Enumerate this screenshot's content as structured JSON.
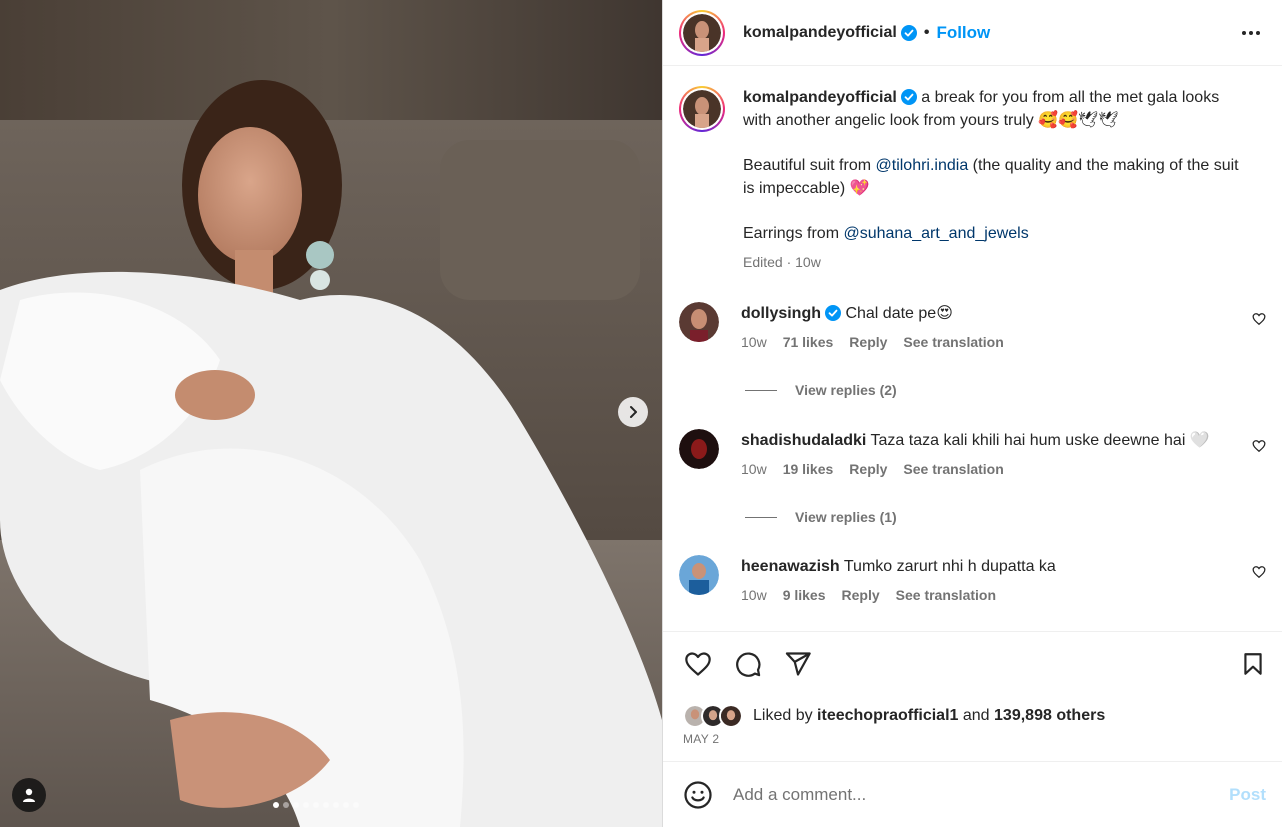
{
  "post": {
    "author": "komalpandeyofficial",
    "follow_label": "Follow",
    "separator": "•",
    "caption_line1": "a break for you from all the met gala looks with another angelic look from yours truly 🥰🥰🕊🕊",
    "caption_p2_a": "Beautiful suit from ",
    "caption_p2_link": "@tilohri.india",
    "caption_p2_b": " (the quality and the making of the suit is impeccable) 💖",
    "caption_p3_a": "Earrings from ",
    "caption_p3_link": "@suhana_art_and_jewels",
    "caption_meta": "Edited · 10w",
    "carousel": {
      "count": 9,
      "active": 0
    }
  },
  "comments": [
    {
      "user": "dollysingh",
      "verified": true,
      "text": "Chal date pe😍",
      "time": "10w",
      "likes": "71 likes",
      "reply": "Reply",
      "translate": "See translation",
      "view_replies": "View replies (2)"
    },
    {
      "user": "shadishudaladki",
      "verified": false,
      "text": "Taza taza kali khili hai hum uske deewne hai 🤍",
      "time": "10w",
      "likes": "19 likes",
      "reply": "Reply",
      "translate": "See translation",
      "view_replies": "View replies (1)"
    },
    {
      "user": "heenawazish",
      "verified": false,
      "text": "Tumko zarurt nhi h dupatta ka",
      "time": "10w",
      "likes": "9 likes",
      "reply": "Reply",
      "translate": "See translation"
    }
  ],
  "footer": {
    "liked_by_prefix": "Liked by ",
    "liked_by_user": "iteechopraofficial1",
    "liked_by_and": " and ",
    "liked_by_count": "139,898 others",
    "date": "MAY 2"
  },
  "add_comment": {
    "placeholder": "Add a comment...",
    "post_label": "Post"
  },
  "icons": {
    "like": "heart-icon",
    "comment": "comment-icon",
    "share": "paper-plane-icon",
    "save": "bookmark-icon",
    "more": "ellipsis-icon",
    "emoji": "emoji-icon",
    "next": "chevron-right-icon",
    "tags": "user-tag-icon"
  },
  "colors": {
    "accent": "#0095f6",
    "link": "#00376b",
    "muted": "#737373",
    "post_disabled": "#b2dffc"
  }
}
